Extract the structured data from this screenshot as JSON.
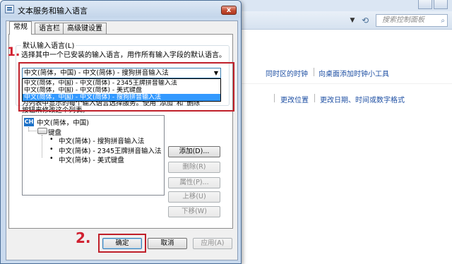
{
  "background": {
    "search_placeholder": "搜索控制面板",
    "link_clock": "同时区的时钟",
    "link_gadget": "向桌面添加时钟小工具",
    "link_location": "更改位置",
    "link_formats": "更改日期、时间或数字格式"
  },
  "dialog": {
    "title": "文本服务和输入语言",
    "close_glyph": "x",
    "tabs": [
      {
        "label": "常规"
      },
      {
        "label": "语言栏"
      },
      {
        "label": "高级键设置"
      }
    ],
    "default_language": {
      "group_label": "默认输入语言(L)",
      "description": "选择其中一个已安装的输入语言，用作所有输入字段的默认语言。",
      "selected_value": "中文(简体，中国) - 中文(简体) - 搜狗拼音输入法",
      "options": [
        "中文(简体，中国) - 中文(简体) - 2345王牌拼音输入法",
        "中文(简体，中国) - 中文(简体) - 美式键盘",
        "中文(简体，中国) - 中文(简体) - 搜狗拼音输入法"
      ],
      "highlighted_index": 2
    },
    "installed_services": {
      "hint_line1": "为列表中显示的每个输入语言选择服务。使用“添加”和“删除”",
      "hint_line2": "按钮来修改这个列表。",
      "language_badge": "CH",
      "language": "中文(简体，中国)",
      "category": "键盘",
      "items": [
        "中文(简体) - 搜狗拼音输入法",
        "中文(简体) - 2345王牌拼音输入法",
        "中文(简体) - 美式键盘"
      ],
      "buttons": {
        "add": "添加(D)...",
        "remove": "删除(R)",
        "properties": "属性(P)...",
        "move_up": "上移(U)",
        "move_down": "下移(W)"
      }
    },
    "footer": {
      "ok": "确定",
      "cancel": "取消",
      "apply": "应用(A)"
    }
  },
  "annotations": {
    "step1": "1.",
    "step2": "2."
  },
  "colors": {
    "annotation_red": "#c0202a",
    "selection_blue": "#3399ff",
    "link_blue": "#1e4fa3"
  }
}
